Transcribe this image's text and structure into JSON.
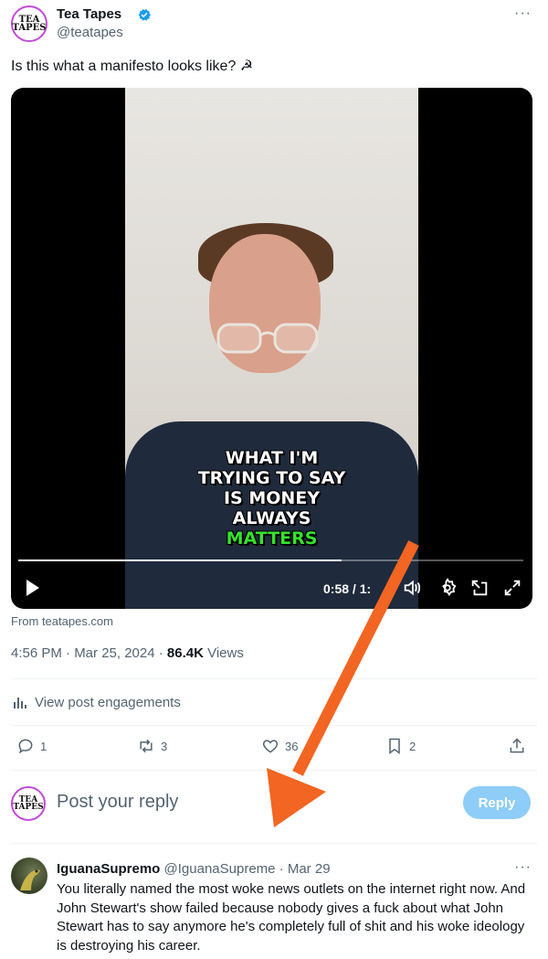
{
  "post": {
    "author_name": "Tea Tapes",
    "author_handle": "@teatapes",
    "avatar_text": "TEA TAPES",
    "text": "Is this what a manifesto looks like? ☭",
    "source": "From teatapes.com",
    "timestamp": "4:56 PM · Mar 25, 2024 · ",
    "views_count": "86.4K",
    "views_label": " Views",
    "engagements_label": "View post engagements"
  },
  "video": {
    "caption_lines": [
      "WHAT I'M",
      "TRYING TO SAY",
      "IS MONEY",
      "ALWAYS"
    ],
    "caption_highlight": "MATTERS",
    "time_display": "0:58 / 1:",
    "progress": 0.64
  },
  "actions": {
    "replies": "1",
    "reposts": "3",
    "likes": "36",
    "bookmarks": "2"
  },
  "reply_box": {
    "placeholder": "Post your reply",
    "button_label": "Reply"
  },
  "comment": {
    "author_name": "IguanaSupremo",
    "author_handle": "@IguanaSupreme",
    "date": " · Mar 29",
    "text": "You literally named the most woke news outlets on the internet right now. And John Stewart's show failed because nobody gives a fuck about what John Stewart has to say anymore he's completely full of shit and his woke ideology is destroying his career."
  },
  "colors": {
    "accent": "#1d9bf0",
    "reply_button": "#8ecdf7",
    "arrow": "#f26522",
    "caption_highlight": "#37e12f"
  },
  "icons": [
    "verified-badge-icon",
    "more-icon",
    "play-icon",
    "volume-icon",
    "settings-icon",
    "dock-icon",
    "fullscreen-icon",
    "analytics-icon",
    "reply-icon",
    "repost-icon",
    "like-icon",
    "bookmark-icon",
    "share-icon"
  ]
}
